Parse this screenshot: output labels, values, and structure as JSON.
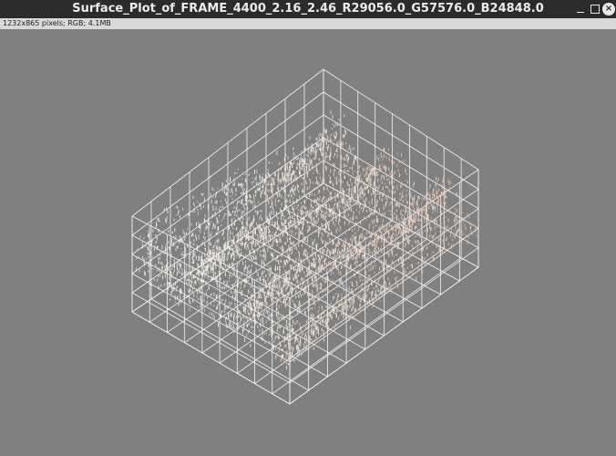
{
  "window": {
    "title": "Surface_Plot_of_FRAME_4400_2.16_2.46_R29056.0_G57576.0_B24848.0",
    "controls": {
      "minimize_icon": "minimize-icon",
      "maximize_icon": "maximize-icon",
      "close_icon": "close-icon",
      "close_glyph": "×"
    }
  },
  "info_bar": {
    "text": "1232x865 pixels; RGB; 4.1MB"
  },
  "colors": {
    "title_bar": "#2b2b2b",
    "info_bar": "#d9d9d9",
    "canvas_background": "#808080",
    "grid_lines": "#f2f2f2",
    "surface_light": "#f4f1ea",
    "surface_warm": "#e8b896"
  }
}
